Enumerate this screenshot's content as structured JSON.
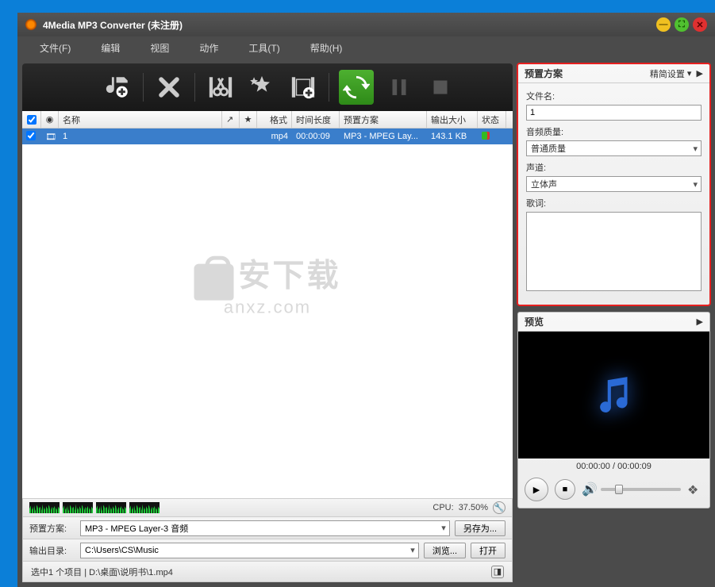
{
  "title": "4Media MP3 Converter (未注册)",
  "menu": [
    "文件(F)",
    "编辑",
    "视图",
    "动作",
    "工具(T)",
    "帮助(H)"
  ],
  "cols": {
    "chk": "",
    "ps": "",
    "name": "名称",
    "arr": "↗",
    "star": "★",
    "fmt": "格式",
    "time": "时间长度",
    "profile": "预置方案",
    "size": "输出大小",
    "stat": "状态"
  },
  "row": {
    "name": "1",
    "fmt": "mp4",
    "time": "00:00:09",
    "profile": "MP3 - MPEG Lay...",
    "size": "143.1 KB"
  },
  "watermark": {
    "line1": "安下载",
    "line2": "anxz.com"
  },
  "cpu": {
    "label": "CPU:",
    "value": "37.50%"
  },
  "profile": {
    "label": "预置方案:",
    "value": "MP3 - MPEG Layer-3 音频",
    "saveas": "另存为..."
  },
  "outdir": {
    "label": "输出目录:",
    "value": "C:\\Users\\CS\\Music",
    "browse": "浏览...",
    "open": "打开"
  },
  "status": "选中1 个项目 | D:\\桌面\\说明书\\1.mp4",
  "preset": {
    "title": "预置方案",
    "more": "精简设置",
    "filename_l": "文件名:",
    "filename_v": "1",
    "quality_l": "音频质量:",
    "quality_v": "普通质量",
    "chan_l": "声道:",
    "chan_v": "立体声",
    "lyric_l": "歌词:"
  },
  "preview": {
    "title": "预览",
    "time": "00:00:00 / 00:00:09"
  }
}
